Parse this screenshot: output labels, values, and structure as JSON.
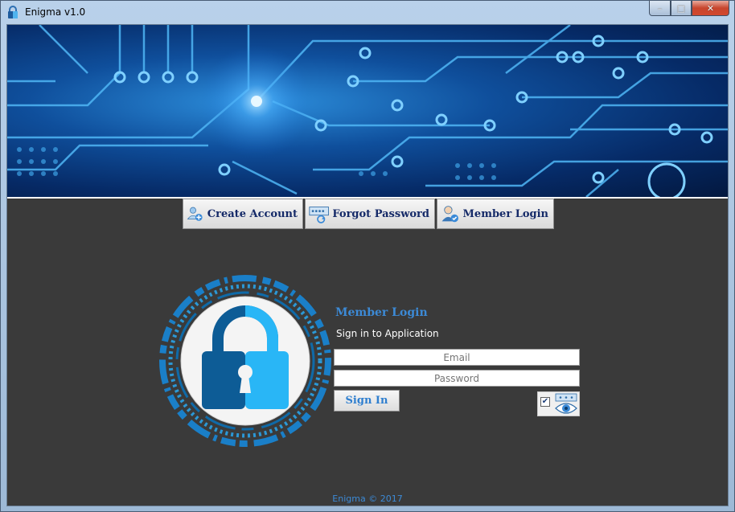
{
  "window": {
    "title": "Enigma v1.0",
    "controls": {
      "minimize": "–",
      "maximize": "□",
      "close": "✕"
    }
  },
  "nav": {
    "create_account": "Create Account",
    "forgot_password": "Forgot Password",
    "member_login": "Member Login"
  },
  "login": {
    "title": "Member Login",
    "subtitle": "Sign in to Application",
    "email_placeholder": "Email",
    "password_placeholder": "Password",
    "sign_in": "Sign In",
    "show_password_checked": "✔"
  },
  "footer": {
    "copyright": "Enigma © 2017"
  },
  "colors": {
    "accent_blue": "#3c8ad6",
    "nav_text": "#152a68",
    "background": "#3a3a3a",
    "lock_dark": "#0d5c96",
    "lock_light": "#29b6f6"
  },
  "icons": {
    "app": "enigma-app-icon",
    "create_account": "add-user-icon",
    "forgot_password": "password-reset-icon",
    "member_login": "user-check-icon",
    "lock": "padlock-icon",
    "show_password": "eye-icon"
  }
}
